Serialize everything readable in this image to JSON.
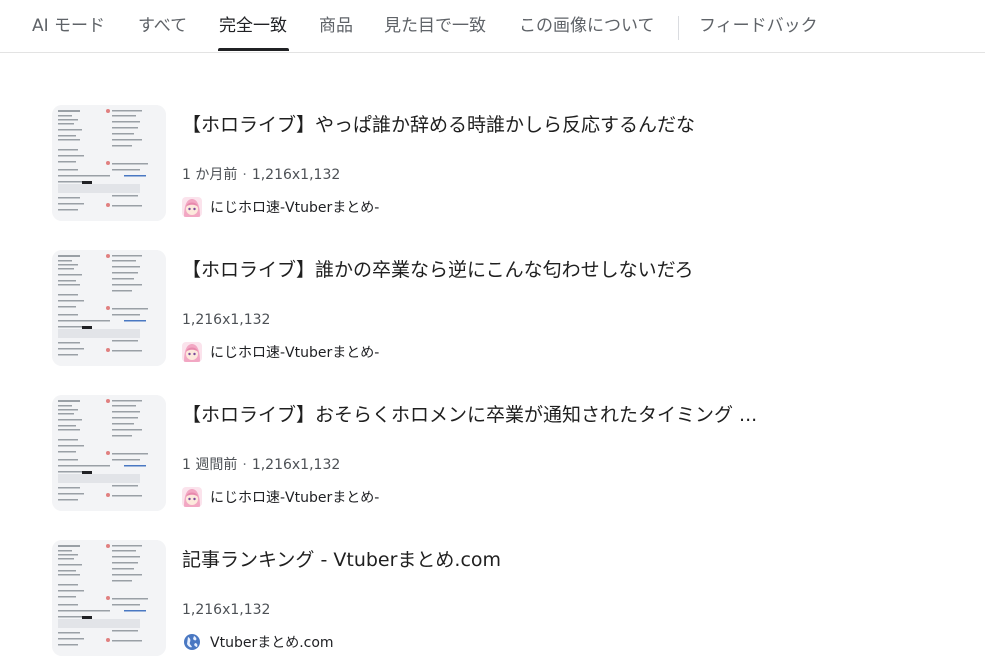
{
  "tabs": [
    {
      "label": "AI モード",
      "active": false
    },
    {
      "label": "すべて",
      "active": false
    },
    {
      "label": "完全一致",
      "active": true
    },
    {
      "label": "商品",
      "active": false
    },
    {
      "label": "見た目で一致",
      "active": false
    },
    {
      "label": "この画像について",
      "active": false
    },
    {
      "label": "フィードバック",
      "active": false
    }
  ],
  "results": [
    {
      "title": "【ホロライブ】やっぱ誰か辞める時誰かしら反応するんだな",
      "age": "1 か月前",
      "dimensions": "1,216x1,132",
      "source": "にじホロ速-Vtuberまとめ-",
      "favicon": "anime-avatar-icon"
    },
    {
      "title": "【ホロライブ】誰かの卒業なら逆にこんな匂わせしないだろ",
      "age": "",
      "dimensions": "1,216x1,132",
      "source": "にじホロ速-Vtuberまとめ-",
      "favicon": "anime-avatar-icon"
    },
    {
      "title": "【ホロライブ】おそらくホロメンに卒業が通知されたタイミング ...",
      "age": "1 週間前",
      "dimensions": "1,216x1,132",
      "source": "にじホロ速-Vtuberまとめ-",
      "favicon": "anime-avatar-icon"
    },
    {
      "title": "記事ランキング - Vtuberまとめ.com",
      "age": "",
      "dimensions": "1,216x1,132",
      "source": "Vtuberまとめ.com",
      "favicon": "globe-icon"
    }
  ],
  "colors": {
    "active_tab": "#202124",
    "inactive_tab": "#5f6368",
    "meta_text": "#4d5156",
    "divider": "#e3e3e3"
  }
}
